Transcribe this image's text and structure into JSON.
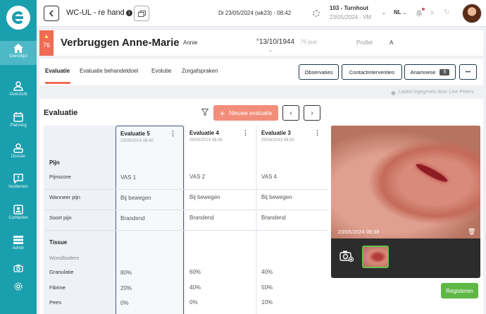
{
  "sidebar": {
    "items": [
      {
        "label": "Dienstlijst",
        "icon": "home-icon"
      },
      {
        "label": "Overzicht",
        "icon": "person-list-icon"
      },
      {
        "label": "Planning",
        "icon": "calendar-icon"
      },
      {
        "label": "Dossier",
        "icon": "person-folder-icon"
      },
      {
        "label": "Incidenten",
        "icon": "alert-message-icon"
      },
      {
        "label": "Contacten",
        "icon": "contact-card-icon"
      },
      {
        "label": "Admin",
        "icon": "server-icon"
      }
    ]
  },
  "topbar": {
    "title": "WC-UL - re hand",
    "date": "Di 23/05/2024 (wk23) - 08:42",
    "location": "103 - Turnhout",
    "location_sub": "23/05/2024 - VM",
    "language": "NL"
  },
  "patient": {
    "age": "76",
    "name": "Verbruggen Anne-Marie",
    "nickname": "Annie",
    "dob": "°13/10/1944",
    "age_years": "76 jaar",
    "profiel_label": "Profiel",
    "profiel_value": "A"
  },
  "tabs": [
    {
      "label": "Evaluatie"
    },
    {
      "label": "Evaluatie behandeldoel"
    },
    {
      "label": "Evolutie"
    },
    {
      "label": "Zorgafspraken"
    }
  ],
  "actions": {
    "observaties": "Observaties",
    "contactinterventies": "Contactinterventies",
    "anamnese": "Anamnese",
    "anamnese_count": "5",
    "more": "•••"
  },
  "last_entered": "Laatst ingegeven door Line Peters",
  "panel": {
    "title": "Evaluatie",
    "new_eval": "Nieuwe evaluatie",
    "register": "Registeren",
    "photo_date": "23/05/2024 08:38"
  },
  "table": {
    "rows": {
      "pijn": "Pijn",
      "pijnscore": "Pijnscore",
      "wanneer": "Wanneer pijn",
      "soort": "Soort pijn",
      "tissue": "Tissue",
      "wondbodem": "Wondbodem",
      "granulatie": "Granulatie",
      "fibrine": "Fibrine",
      "pees": "Pees"
    },
    "columns": [
      {
        "title": "Evaluatie 5",
        "date": "23/05/2024 08:40",
        "pijnscore": "VAS 1",
        "wanneer": "Bij bewegen",
        "soort": "Brandend",
        "granulatie": "80%",
        "fibrine": "20%",
        "pees": "0%"
      },
      {
        "title": "Evaluatie 4",
        "date": "09/05/2024 08:36",
        "pijnscore": "VAS 2",
        "wanneer": "Bij bewegen",
        "soort": "Brandend",
        "granulatie": "60%",
        "fibrine": "40%",
        "pees": "0%"
      },
      {
        "title": "Evaluatie 3",
        "date": "25/04/2043 08:50",
        "pijnscore": "VAS 4",
        "wanneer": "Bij bewegen",
        "soort": "Brandend",
        "granulatie": "40%",
        "fibrine": "50%",
        "pees": "10%"
      }
    ]
  },
  "colors": {
    "sidebar": "#1a9fae",
    "accent": "#ef6b54",
    "register": "#5fb845"
  }
}
